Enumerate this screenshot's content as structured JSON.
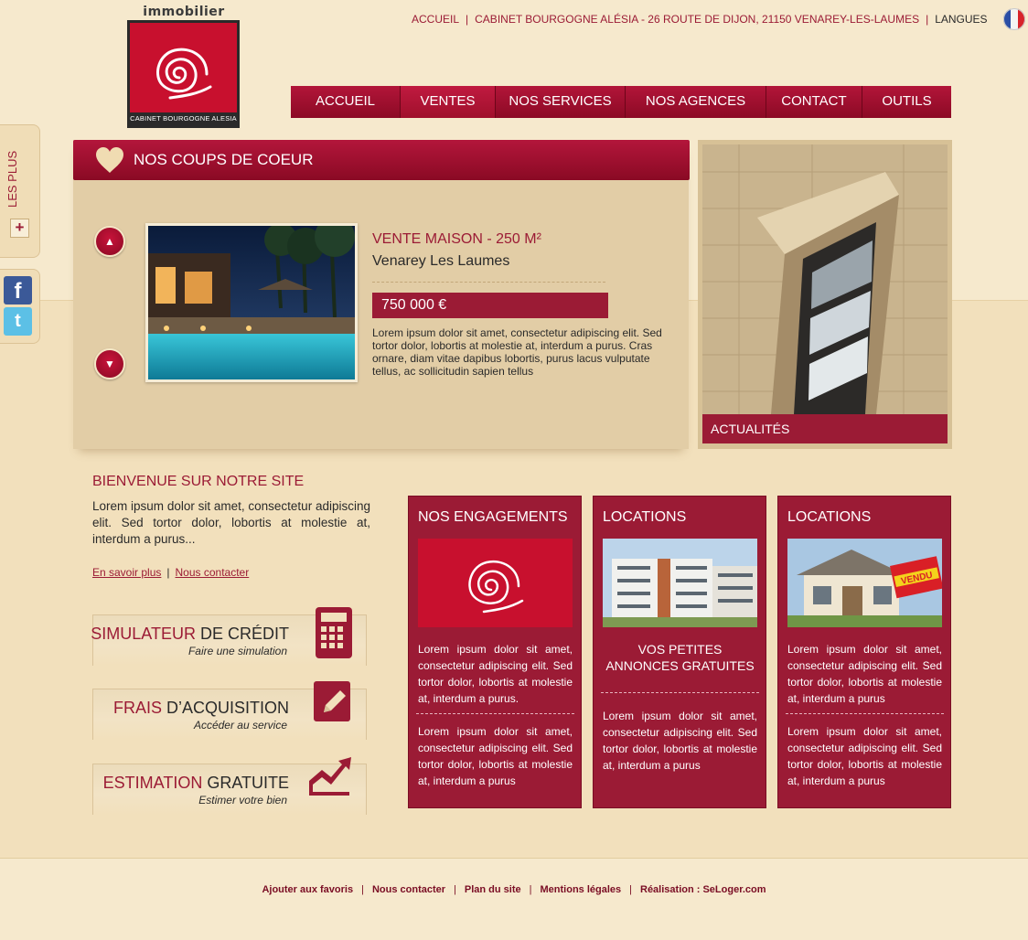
{
  "logo": {
    "word": "immobilier",
    "caption": "CABINET BOURGOGNE ALESIA"
  },
  "toplinks": {
    "home": "ACCUEIL",
    "address": "CABINET BOURGOGNE ALÉSIA - 26 ROUTE DE DIJON, 21150 VENAREY-LES-LAUMES",
    "languages": "LANGUES"
  },
  "nav": {
    "items": [
      "ACCUEIL",
      "VENTES",
      "NOS SERVICES",
      "NOS AGENCES",
      "CONTACT",
      "OUTILS"
    ],
    "active": "VENTES"
  },
  "side": {
    "les_plus": "LES PLUS",
    "plus_symbol": "+"
  },
  "social": {
    "facebook": "f",
    "twitter": "t"
  },
  "coeur": {
    "title": "NOS COUPS DE COEUR",
    "property": {
      "type": "VENTE MAISON - 250 M²",
      "city": "Venarey Les Laumes",
      "price": "750 000 €",
      "description": "Lorem ipsum dolor sit amet, consectetur adipiscing elit. Sed tortor dolor, lobortis at molestie at, interdum a purus. Cras ornare, diam vitae dapibus lobortis, purus lacus vulputate tellus, ac sollicitudin sapien tellus"
    }
  },
  "actualites": {
    "label": "ACTUALITÉS"
  },
  "bienvenue": {
    "title": "BIENVENUE SUR NOTRE SITE",
    "text": "Lorem ipsum dolor sit amet, consectetur adipiscing elit. Sed tortor dolor, lobortis at molestie at, interdum a purus...",
    "link_more": "En savoir plus",
    "link_contact": "Nous contacter"
  },
  "tools": [
    {
      "accent": "SIMULATEUR",
      "rest": " DE CRÉDIT",
      "subtitle": "Faire une simulation",
      "icon": "calculator-icon"
    },
    {
      "accent": "FRAIS",
      "rest": " D’ACQUISITION",
      "subtitle": "Accéder au service",
      "icon": "pencil-icon"
    },
    {
      "accent": "ESTIMATION",
      "rest": " GRATUITE",
      "subtitle": "Estimer votre bien",
      "icon": "chart-icon"
    }
  ],
  "cards": {
    "engagements": {
      "title": "NOS ENGAGEMENTS",
      "text1": "Lorem ipsum dolor sit amet, consectetur adipiscing elit. Sed tortor dolor, lobortis at molestie at, interdum a purus.",
      "text2": "Lorem ipsum dolor sit amet, consectetur adipiscing elit. Sed tortor dolor, lobortis at molestie at, interdum a purus"
    },
    "locations1": {
      "title": "LOCATIONS",
      "headline": "VOS PETITES ANNONCES GRATUITES",
      "text1": "Lorem ipsum dolor sit amet, consectetur adipiscing elit. Sed tortor dolor, lobortis at molestie at, interdum a purus"
    },
    "locations2": {
      "title": "LOCATIONS",
      "sign": "VENDU",
      "text1": "Lorem ipsum dolor sit amet, consectetur adipiscing elit. Sed tortor dolor, lobortis at molestie at, interdum a purus",
      "text2": "Lorem ipsum dolor sit amet, consectetur adipiscing elit. Sed tortor dolor, lobortis at molestie at, interdum a purus"
    }
  },
  "footer": {
    "links": [
      "Ajouter aux favoris",
      "Nous contacter",
      "Plan du site",
      "Mentions légales",
      "Réalisation : SeLoger.com"
    ]
  },
  "colors": {
    "brand_red": "#9b1b35",
    "logo_red": "#c8102e",
    "background": "#f6e9cd"
  }
}
